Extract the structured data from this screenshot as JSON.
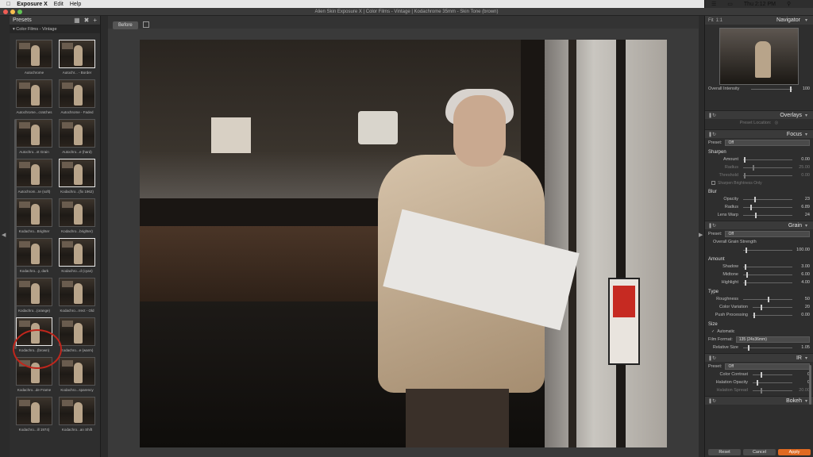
{
  "menubar": {
    "app": "Exposure X",
    "edit": "Edit",
    "help": "Help",
    "clock": "Thu 2:12 PM"
  },
  "window": {
    "title": "Alien Skin Exposure X | Color Films - Vintage | Kodachrome 35mm - Skin Tone (brown)"
  },
  "left_panel": {
    "title": "Presets",
    "category": "Color Films - Vintage",
    "presets": [
      {
        "label": "Autochrome"
      },
      {
        "label": "Autochr... - Border"
      },
      {
        "label": "Autochrome...cratches"
      },
      {
        "label": "Autochrome - Faded"
      },
      {
        "label": "Autochro...st Grain"
      },
      {
        "label": "Autochro...e (hard)"
      },
      {
        "label": "Autochrom...te (soft)"
      },
      {
        "label": "Kodachro...(fix 1962)"
      },
      {
        "label": "Kodachro...Brighter"
      },
      {
        "label": "Kodachro...brighter)"
      },
      {
        "label": "Kodachro...y, dark"
      },
      {
        "label": "Kodachro...d (cyan)"
      },
      {
        "label": "Kodachro...(orange)"
      },
      {
        "label": "Kodachro...rrect - Old"
      },
      {
        "label": "Kodachro...(brown)"
      },
      {
        "label": "Kodachro...e (warm)"
      },
      {
        "label": "Kodachro...de Frame"
      },
      {
        "label": "Kodachro...sparency"
      },
      {
        "label": "Kodachro...ill 1974)"
      },
      {
        "label": "Kodachro...an Shift"
      }
    ]
  },
  "center": {
    "before_label": "Before"
  },
  "right_panel": {
    "navigator": {
      "title": "Navigator",
      "fit": "Fit",
      "ratio": "1:1",
      "intensity_label": "Overall Intensity",
      "intensity_value": "100"
    },
    "overlays": {
      "title": "Overlays",
      "preset_location": "Preset Location:"
    },
    "focus": {
      "title": "Focus",
      "preset_label": "Preset:",
      "preset_value": "Off",
      "sharpen": "Sharpen",
      "amount": {
        "label": "Amount",
        "value": "0.00"
      },
      "radius": {
        "label": "Radius",
        "value": "25.00"
      },
      "threshold": {
        "label": "Threshold",
        "value": "0.00"
      },
      "sharpen_brightness": "Sharpen Brightness Only",
      "blur": "Blur",
      "opacity": {
        "label": "Opacity",
        "value": "23"
      },
      "blur_radius": {
        "label": "Radius",
        "value": "6.89"
      },
      "lens_warp": {
        "label": "Lens Warp",
        "value": "24"
      }
    },
    "grain": {
      "title": "Grain",
      "preset_label": "Preset:",
      "preset_value": "Off",
      "overall_label": "Overall Grain Strength",
      "overall_value": "100.00",
      "amount": "Amount",
      "shadow": {
        "label": "Shadow",
        "value": "3.00"
      },
      "midtone": {
        "label": "Midtone",
        "value": "6.00"
      },
      "highlight": {
        "label": "Highlight",
        "value": "4.00"
      },
      "type": "Type",
      "roughness": {
        "label": "Roughness",
        "value": "50"
      },
      "color_variation": {
        "label": "Color Variation",
        "value": "20"
      },
      "push_processing": {
        "label": "Push Processing",
        "value": "0.00"
      },
      "size": "Size",
      "automatic": "Automatic",
      "film_format_label": "Film Format:",
      "film_format_value": "135 (24x36mm)",
      "relative_size": {
        "label": "Relative Size",
        "value": "1.05"
      }
    },
    "ir": {
      "title": "IR",
      "preset_label": "Preset:",
      "preset_value": "Off",
      "color_contrast": {
        "label": "Color Contrast",
        "value": "0"
      },
      "halation_opacity": {
        "label": "Halation Opacity",
        "value": "0"
      },
      "halation_spread": {
        "label": "Halation Spread",
        "value": "20.00"
      }
    },
    "bokeh": {
      "title": "Bokeh"
    },
    "buttons": {
      "reset": "Reset",
      "cancel": "Cancel",
      "apply": "Apply"
    }
  },
  "colors": {
    "accent": "#e06a22",
    "annotation": "#c0261c"
  }
}
